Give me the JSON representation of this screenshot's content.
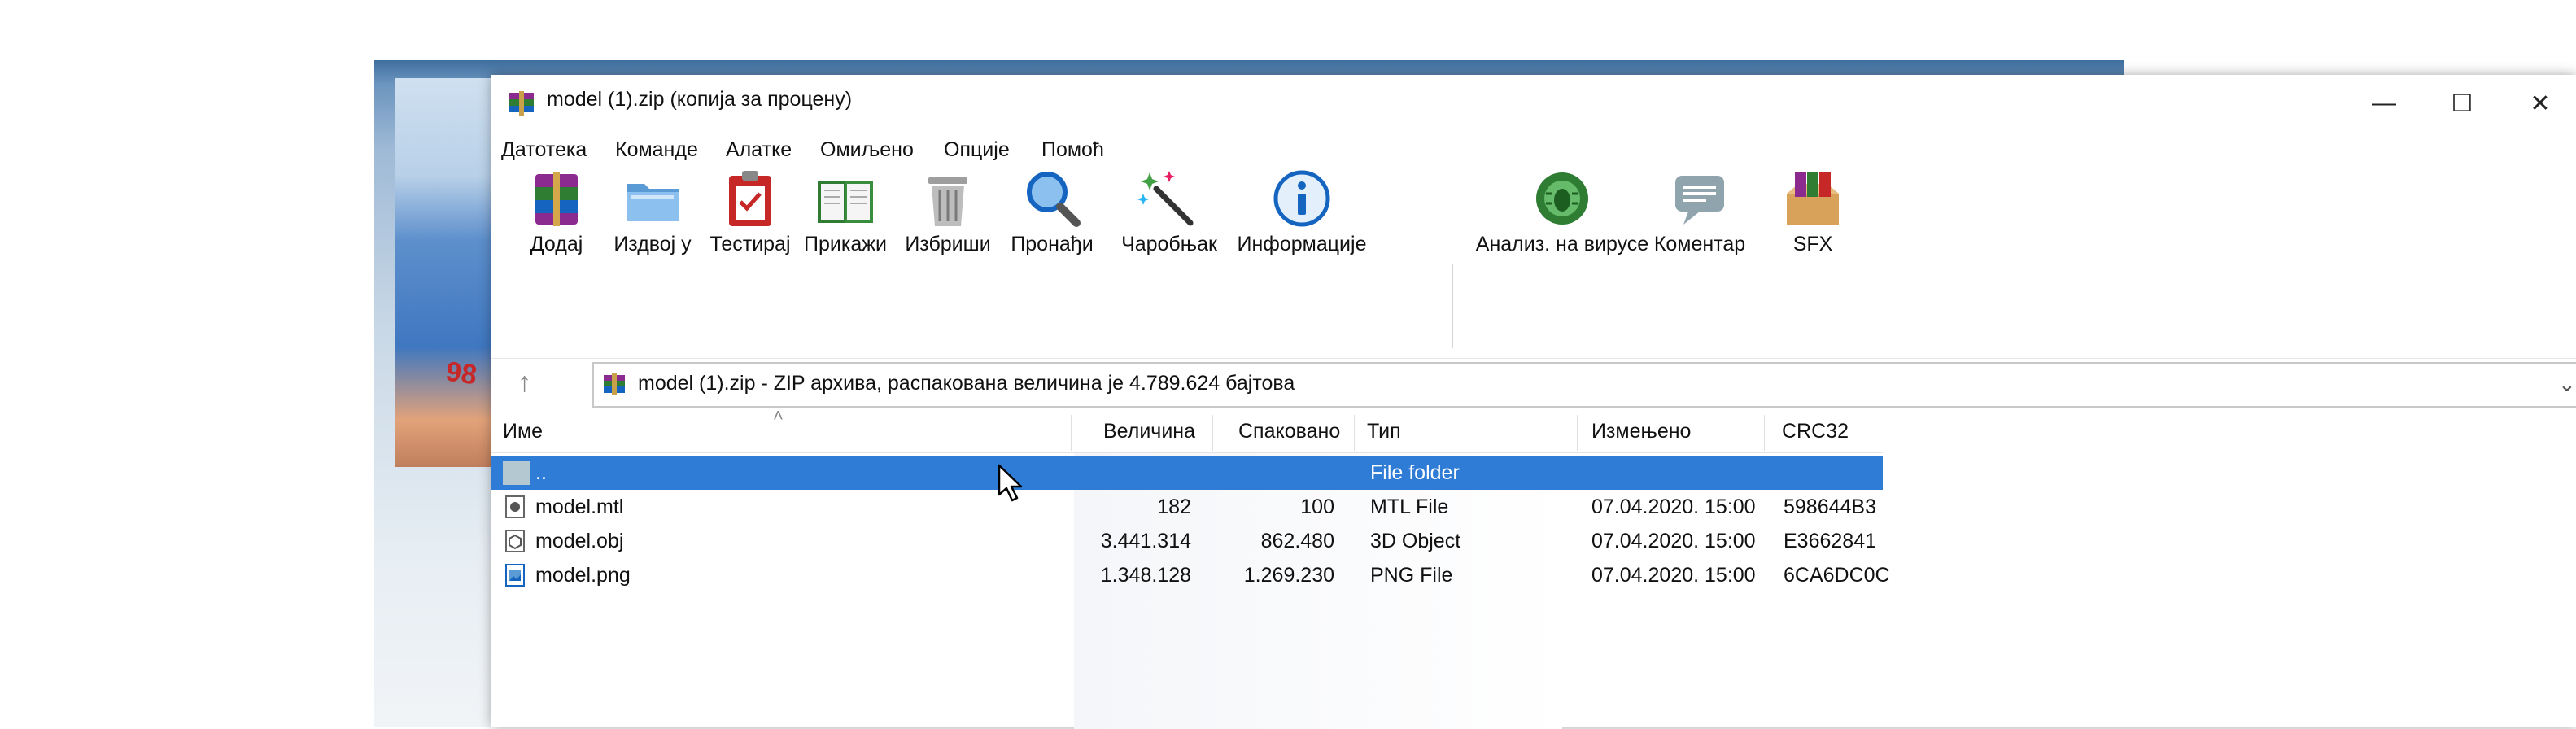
{
  "background": {
    "photo_text": "98"
  },
  "window": {
    "title": "model (1).zip (копија за процену)",
    "controls": {
      "minimize": "—",
      "maximize": "☐",
      "close": "✕"
    }
  },
  "menu": [
    "Датотека",
    "Команде",
    "Алатке",
    "Омиљено",
    "Опције",
    "Помоћ"
  ],
  "toolbar": [
    {
      "label": "Додај",
      "icon": "add-archive-icon"
    },
    {
      "label": "Издвој у",
      "icon": "extract-to-icon"
    },
    {
      "label": "Тестирај",
      "icon": "test-icon"
    },
    {
      "label": "Прикажи",
      "icon": "view-icon"
    },
    {
      "label": "Избриши",
      "icon": "delete-icon"
    },
    {
      "label": "Пронађи",
      "icon": "find-icon"
    },
    {
      "label": "Чаробњак",
      "icon": "wizard-icon"
    },
    {
      "label": "Информације",
      "icon": "info-icon"
    },
    {
      "label": "Анализ. на вирусе",
      "icon": "virus-scan-icon"
    },
    {
      "label": "Коментар",
      "icon": "comment-icon"
    },
    {
      "label": "SFX",
      "icon": "sfx-icon"
    }
  ],
  "address": {
    "text": "model (1).zip - ZIP архива, распакована величина је 4.789.624 бајтова"
  },
  "columns": [
    "Име",
    "Величина",
    "Спаковано",
    "Тип",
    "Измењено",
    "CRC32"
  ],
  "rows": [
    {
      "name": "..",
      "size": "",
      "packed": "",
      "type": "File folder",
      "modified": "",
      "crc": "",
      "selected": true
    },
    {
      "name": "model.mtl",
      "size": "182",
      "packed": "100",
      "type": "MTL File",
      "modified": "07.04.2020. 15:00",
      "crc": "598644B3",
      "selected": false
    },
    {
      "name": "model.obj",
      "size": "3.441.314",
      "packed": "862.480",
      "type": "3D Object",
      "modified": "07.04.2020. 15:00",
      "crc": "E3662841",
      "selected": false
    },
    {
      "name": "model.png",
      "size": "1.348.128",
      "packed": "1.269.230",
      "type": "PNG File",
      "modified": "07.04.2020. 15:00",
      "crc": "6CA6DC0C",
      "selected": false
    }
  ],
  "colors": {
    "selection": "#2f7cd6",
    "title_bar": "#ffffff"
  }
}
